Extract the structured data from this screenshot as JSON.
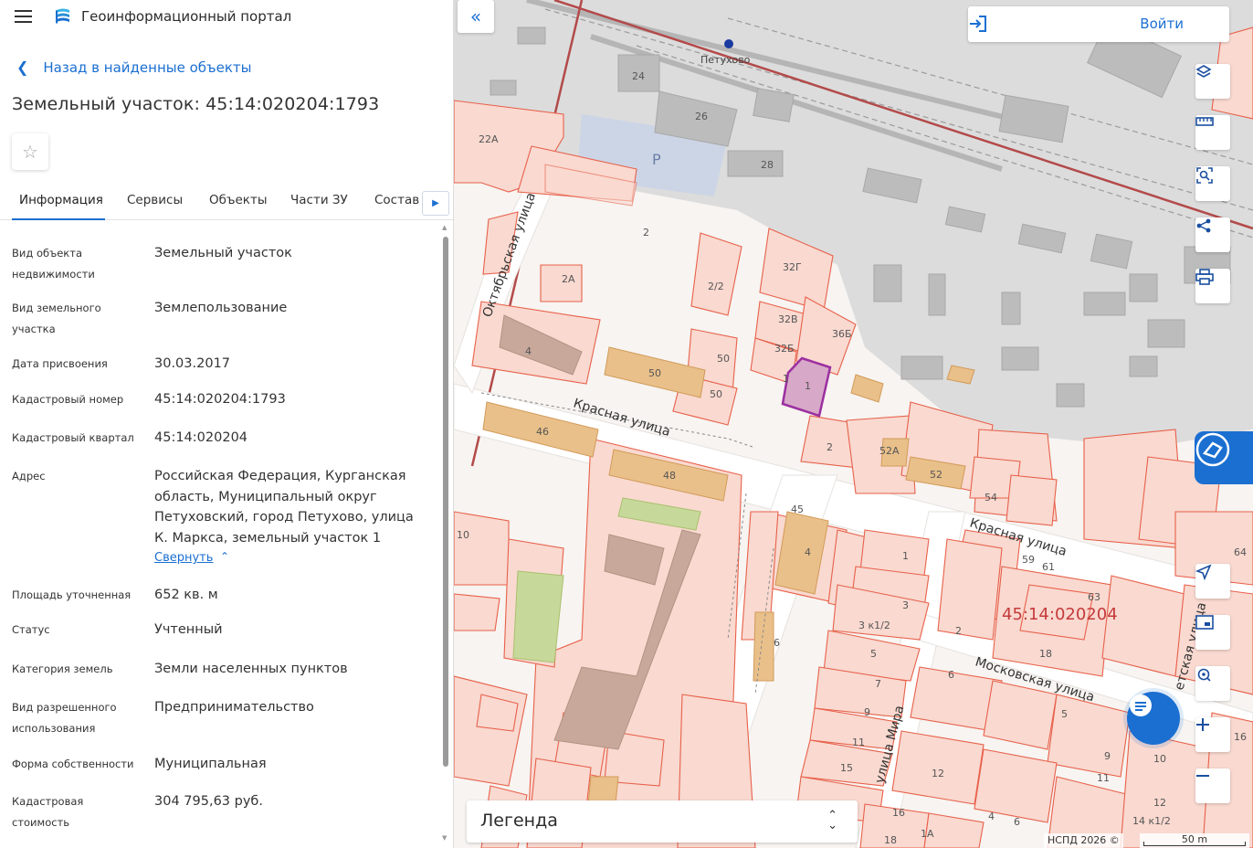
{
  "app": {
    "title": "Геоинформационный портал"
  },
  "nav": {
    "back_label": "Назад в найденные объекты"
  },
  "object": {
    "title": "Земельный участок: 45:14:020204:1793"
  },
  "tabs": [
    {
      "label": "Информация",
      "active": true
    },
    {
      "label": "Сервисы"
    },
    {
      "label": "Объекты"
    },
    {
      "label": "Части ЗУ"
    },
    {
      "label": "Состав"
    }
  ],
  "info": [
    {
      "label": "Вид объекта недвижимости",
      "value": "Земельный участок"
    },
    {
      "label": "Вид земельного участка",
      "value": "Землепользование"
    },
    {
      "label": "Дата присвоения",
      "value": "30.03.2017"
    },
    {
      "label": "Кадастровый номер",
      "value": "45:14:020204:1793"
    },
    {
      "label": "Кадастровый квартал",
      "value": "45:14:020204"
    },
    {
      "label": "Адрес",
      "value": "Российская Федерация, Курганская область, Муниципальный округ Петуховский, город Петухово, улица К. Маркса, земельный участок 1"
    },
    {
      "label": "Площадь уточненная",
      "value": "652 кв. м"
    },
    {
      "label": "Статус",
      "value": "Учтенный"
    },
    {
      "label": "Категория земель",
      "value": "Земли населенных пунктов"
    },
    {
      "label": "Вид разрешенного использования",
      "value": "Предпринимательство"
    },
    {
      "label": "Форма собственности",
      "value": "Муниципальная"
    },
    {
      "label": "Кадастровая стоимость",
      "value": "304 795,63 руб."
    }
  ],
  "address_collapse_label": "Свернуть",
  "map": {
    "login_label": "Войти",
    "legend_label": "Легенда",
    "attribution": "НСПД 2026 ©",
    "scale_label": "50 m",
    "quarter_label": "45:14:020204",
    "station_label": "Петухово",
    "streets": {
      "oktyabrskaya": "Октябрьская улица",
      "krasnaya1": "Красная улица",
      "krasnaya2": "Красная улица",
      "moskovskaya": "Московская улица",
      "mira": "улица Мира",
      "sovetskaya": "етская улица"
    },
    "house_numbers": {
      "n24": "24",
      "n26": "26",
      "n28": "28",
      "n22a": "22А",
      "n2": "2",
      "n2a": "2А",
      "n22": "2/2",
      "n4": "4",
      "n50a": "50",
      "n50b": "50",
      "n50c": "50",
      "n46": "46",
      "n48": "48",
      "n32g": "32Г",
      "n32v": "32В",
      "n32b": "32Б",
      "n36b": "36Б",
      "n1a": "1",
      "n1b": "1",
      "n2b": "2",
      "n52a": "52А",
      "n52": "52",
      "n54": "54",
      "n45": "45",
      "n4b": "4",
      "n1c": "1",
      "n3": "3",
      "n3k": "3 к1/2",
      "n5": "5",
      "n7": "7",
      "n9": "9",
      "n11": "11",
      "n15": "15",
      "n6": "6",
      "n59": "59",
      "n61": "61",
      "n63": "63",
      "n64": "64",
      "n10": "10",
      "n18": "18",
      "n12": "12",
      "n4c": "4",
      "n6b": "6",
      "n16": "16",
      "n1a2": "1А",
      "n18b": "18",
      "n10b": "10",
      "n12b": "12",
      "n14": "14 к1/2",
      "n5b": "5",
      "n9b": "9",
      "n11b": "11",
      "n16b": "16",
      "n6c": "6",
      "n2c": "2",
      "p": "P"
    }
  },
  "colors": {
    "accent": "#1b6fd1",
    "parcel_stroke": "#e8604a",
    "parcel_fill": "#f9d9d0",
    "selected_parcel": "#9b2fa0",
    "railway": "#bdbdbd"
  }
}
